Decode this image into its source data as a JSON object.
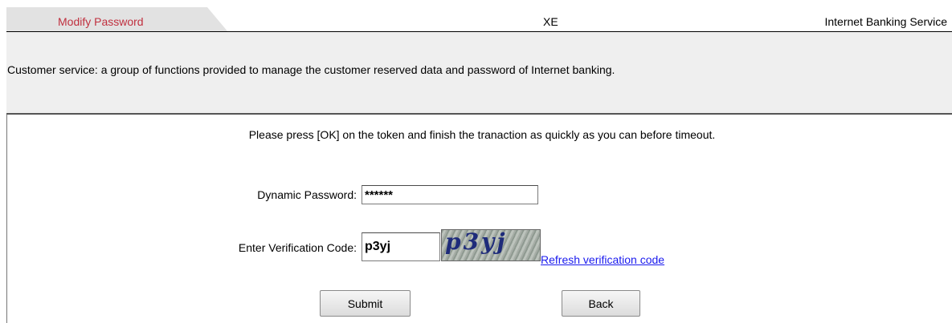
{
  "header": {
    "tab_label": "Modify Password",
    "center_label": "XE",
    "service_label": "Internet Banking Service"
  },
  "description": "Customer service: a group of functions provided to manage the customer reserved data and password of Internet banking.",
  "form": {
    "instruction": "Please press [OK] on the token and finish the tranaction as quickly as you can before timeout.",
    "dynamic_password": {
      "label": "Dynamic Password:",
      "value": "******"
    },
    "verification": {
      "label": "Enter Verification Code:",
      "value": "p3yj",
      "captcha_text": "p3yj",
      "refresh_label": "Refresh verification code"
    },
    "submit_label": "Submit",
    "back_label": "Back"
  },
  "colors": {
    "tab_text": "#c0303f",
    "panel_bg": "#efefef",
    "link": "#1a1aee"
  }
}
